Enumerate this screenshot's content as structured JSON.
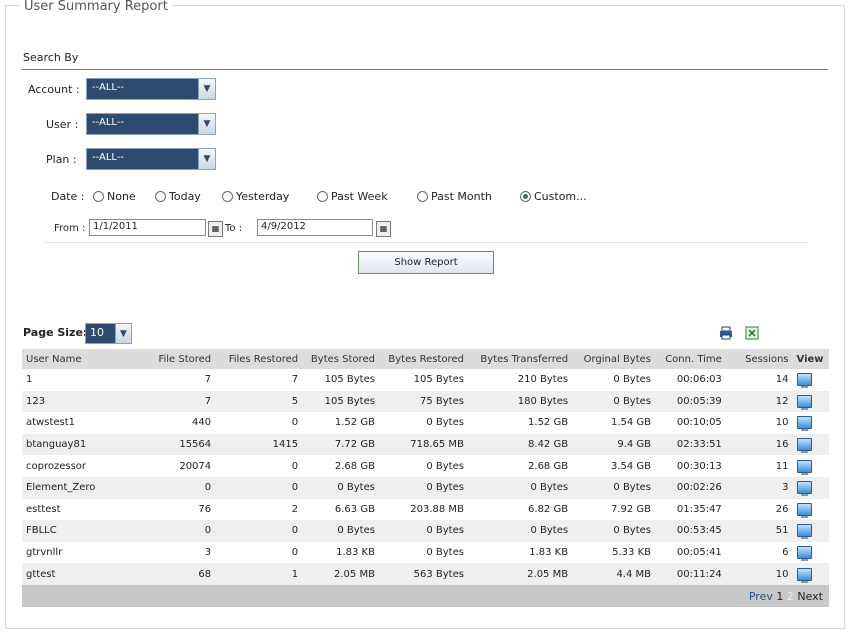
{
  "legend": "User Summary Report",
  "search": {
    "heading": "Search By",
    "account_label": "Account :",
    "account_value": "--ALL--",
    "user_label": "User :",
    "user_value": "--ALL--",
    "plan_label": "Plan :",
    "plan_value": "--ALL--",
    "date_label": "Date :",
    "date_options": [
      "None",
      "Today",
      "Yesterday",
      "Past Week",
      "Past Month",
      "Custom..."
    ],
    "selected_date": "Custom...",
    "from_label": "From :",
    "from_value": "1/1/2011",
    "to_label": "To :",
    "to_value": "4/9/2012",
    "show_button": "Show Report"
  },
  "table_controls": {
    "page_size_label": "Page Size:",
    "page_size_value": "10",
    "print_icon": "printer-icon",
    "excel_icon": "excel-icon"
  },
  "table": {
    "headers": [
      "User Name",
      "File Stored",
      "Files Restored",
      "Bytes Stored",
      "Bytes Restored",
      "Bytes Transferred",
      "Orginal Bytes",
      "Conn. Time",
      "Sessions",
      "View"
    ],
    "rows": [
      [
        "1",
        "7",
        "7",
        "105 Bytes",
        "105 Bytes",
        "210 Bytes",
        "0 Bytes",
        "00:06:03",
        "14"
      ],
      [
        "123",
        "7",
        "5",
        "105 Bytes",
        "75 Bytes",
        "180 Bytes",
        "0 Bytes",
        "00:05:39",
        "12"
      ],
      [
        "atwstest1",
        "440",
        "0",
        "1.52 GB",
        "0 Bytes",
        "1.52 GB",
        "1.54 GB",
        "00:10:05",
        "10"
      ],
      [
        "btanguay81",
        "15564",
        "1415",
        "7.72 GB",
        "718.65 MB",
        "8.42 GB",
        "9.4 GB",
        "02:33:51",
        "16"
      ],
      [
        "coprozessor",
        "20074",
        "0",
        "2.68 GB",
        "0 Bytes",
        "2.68 GB",
        "3.54 GB",
        "00:30:13",
        "11"
      ],
      [
        "Element_Zero",
        "0",
        "0",
        "0 Bytes",
        "0 Bytes",
        "0 Bytes",
        "0 Bytes",
        "00:02:26",
        "3"
      ],
      [
        "esttest",
        "76",
        "2",
        "6.63 GB",
        "203.88 MB",
        "6.82 GB",
        "7.92 GB",
        "01:35:47",
        "26"
      ],
      [
        "FBLLC",
        "0",
        "0",
        "0 Bytes",
        "0 Bytes",
        "0 Bytes",
        "0 Bytes",
        "00:53:45",
        "51"
      ],
      [
        "gtrvnllr",
        "3",
        "0",
        "1.83 KB",
        "0 Bytes",
        "1.83 KB",
        "5.33 KB",
        "00:05:41",
        "6"
      ],
      [
        "gttest",
        "68",
        "1",
        "2.05 MB",
        "563 Bytes",
        "2.05 MB",
        "4.4 MB",
        "00:11:24",
        "10"
      ]
    ]
  },
  "pager": {
    "prev": "Prev",
    "page1": "1",
    "page2": "2",
    "next": "Next"
  }
}
